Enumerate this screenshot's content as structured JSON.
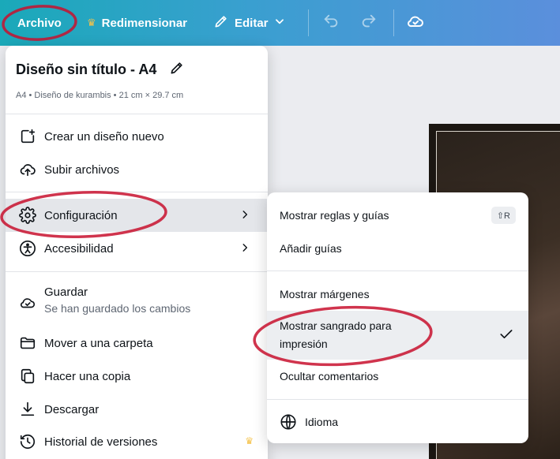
{
  "toolbar": {
    "file_label": "Archivo",
    "resize_label": "Redimensionar",
    "edit_label": "Editar"
  },
  "file_menu": {
    "title": "Diseño sin título - A4",
    "subtitle": "A4 • Diseño de kurambis • 21 cm × 29.7 cm",
    "items": {
      "create": "Crear un diseño nuevo",
      "upload": "Subir archivos",
      "settings": "Configuración",
      "accessibility": "Accesibilidad",
      "save": "Guardar",
      "save_status": "Se han guardado los cambios",
      "move": "Mover a una carpeta",
      "copy": "Hacer una copia",
      "download": "Descargar",
      "history": "Historial de versiones"
    }
  },
  "settings_menu": {
    "show_rulers": "Mostrar reglas y guías",
    "show_rulers_shortcut": "⇧R",
    "add_guides": "Añadir guías",
    "show_margins": "Mostrar márgenes",
    "show_bleed_line1": "Mostrar sangrado para",
    "show_bleed_line2": "impresión",
    "hide_comments": "Ocultar comentarios",
    "language": "Idioma"
  },
  "colors": {
    "accent_red": "#c8102e",
    "crown": "#f5c24a"
  }
}
